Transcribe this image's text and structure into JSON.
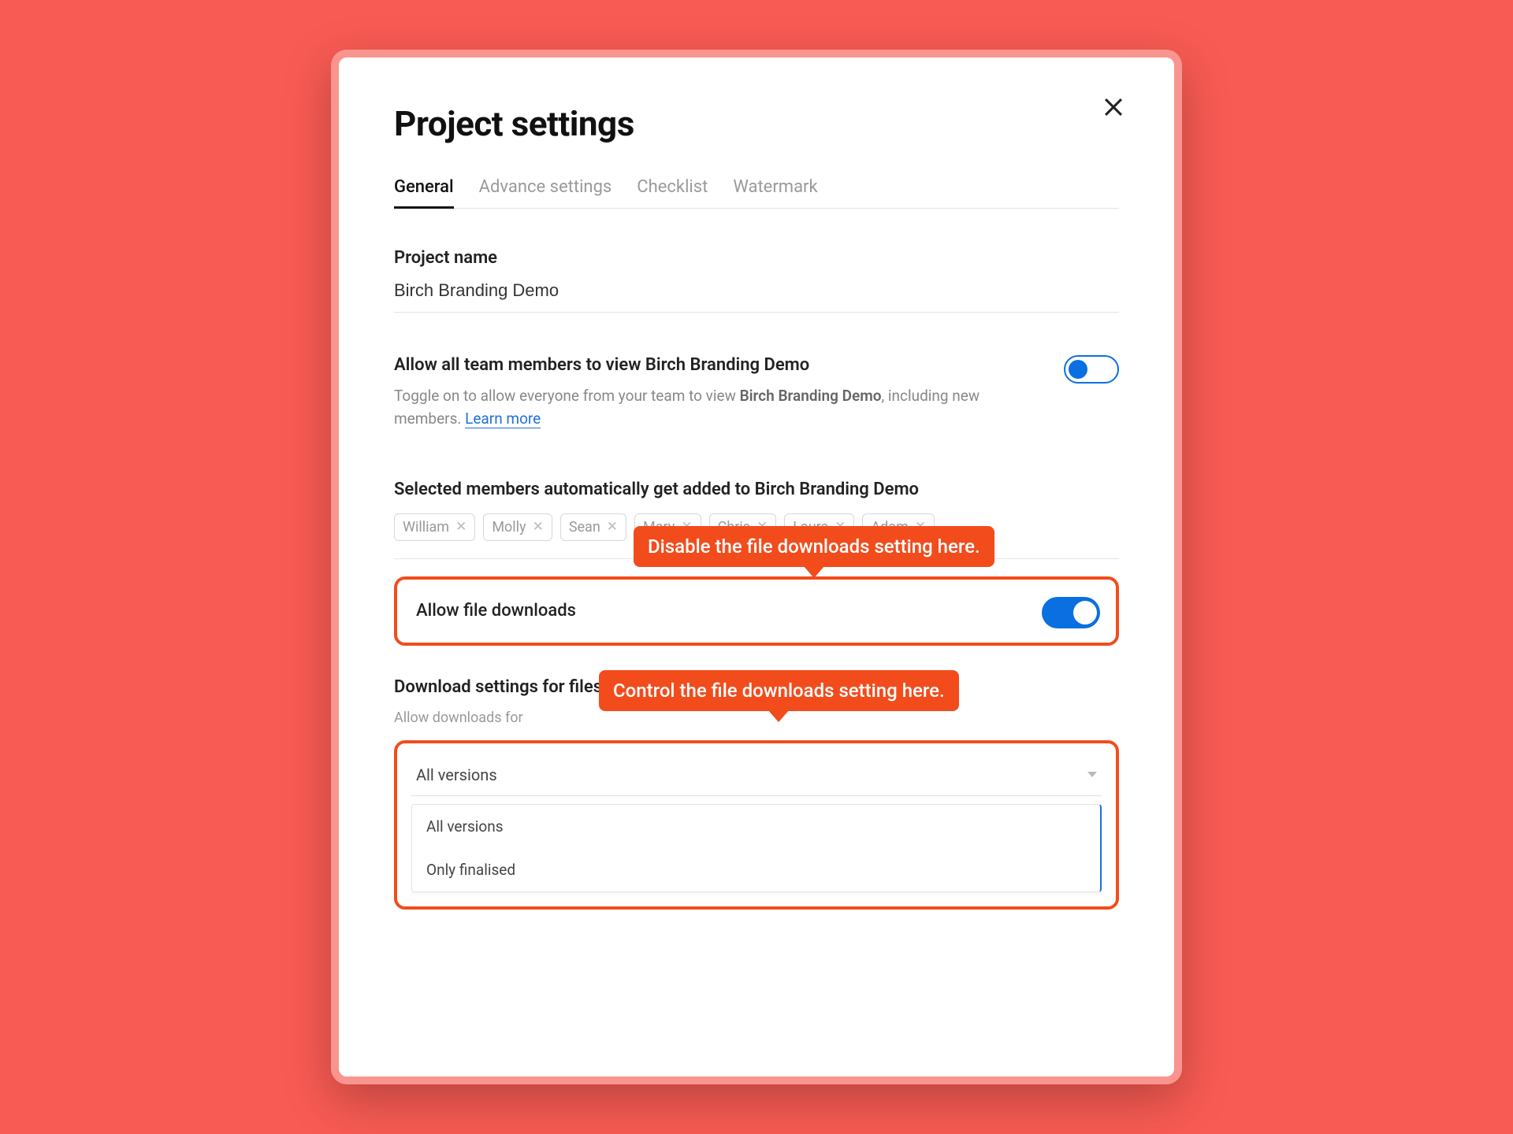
{
  "title": "Project settings",
  "tabs": [
    "General",
    "Advance settings",
    "Checklist",
    "Watermark"
  ],
  "project_name_label": "Project name",
  "project_name_value": "Birch Branding Demo",
  "allow_view": {
    "label": "Allow all team members to view Birch Branding Demo",
    "help_prefix": "Toggle on to allow everyone from your team to view ",
    "help_bold": "Birch Branding Demo",
    "help_suffix": ", including new members. ",
    "learn_more": "Learn more"
  },
  "members_label": "Selected members automatically get added to Birch Branding Demo",
  "members": [
    "William",
    "Molly",
    "Sean",
    "Mary",
    "Chris",
    "Laura",
    "Adam"
  ],
  "callout1": "Disable the file downloads setting here.",
  "allow_downloads_label": "Allow file downloads",
  "download_settings_label": "Download settings for files",
  "download_sub": "Allow downloads for",
  "callout2": "Control the file downloads setting here.",
  "select_value": "All versions",
  "select_options": [
    "All versions",
    "Only finalised"
  ]
}
